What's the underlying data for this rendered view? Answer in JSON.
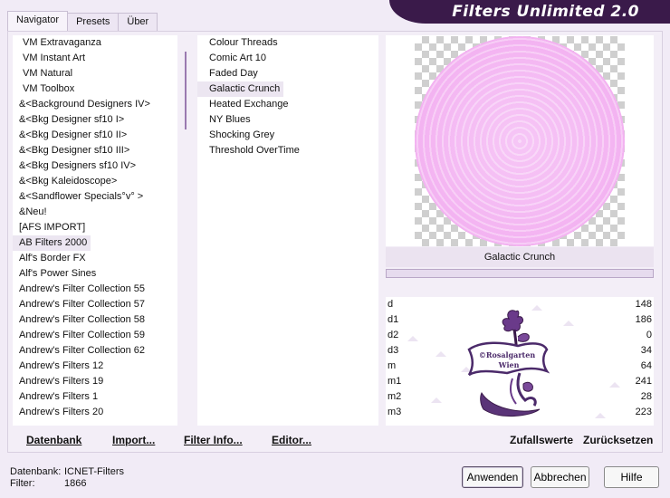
{
  "tabs": [
    "Navigator",
    "Presets",
    "Über"
  ],
  "banner_title": "Filters Unlimited 2.0",
  "categories": [
    "VM Extravaganza",
    "VM Instant Art",
    "VM Natural",
    "VM Toolbox",
    "&<Background Designers IV>",
    "&<Bkg Designer sf10 I>",
    "&<Bkg Designer sf10 II>",
    "&<Bkg Designer sf10 III>",
    "&<Bkg Designers sf10 IV>",
    "&<Bkg Kaleidoscope>",
    "&<Sandflower Specials°v° >",
    "&Neu!",
    "[AFS IMPORT]",
    "AB Filters 2000",
    "Alf's Border FX",
    "Alf's Power Sines",
    "Andrew's Filter Collection 55",
    "Andrew's Filter Collection 57",
    "Andrew's Filter Collection 58",
    "Andrew's Filter Collection 59",
    "Andrew's Filter Collection 62",
    "Andrew's Filters 12",
    "Andrew's Filters 19",
    "Andrew's Filters 1",
    "Andrew's Filters 20"
  ],
  "selected_category": "AB Filters 2000",
  "filters": [
    "Colour Threads",
    "Comic Art 10",
    "Faded Day",
    "Galactic Crunch",
    "Heated Exchange",
    "NY Blues",
    "Shocking Grey",
    "Threshold OverTime"
  ],
  "selected_filter": "Galactic Crunch",
  "preview_filter_name": "Galactic Crunch",
  "params": [
    {
      "name": "d",
      "value": "148"
    },
    {
      "name": "d1",
      "value": "186"
    },
    {
      "name": "d2",
      "value": "0"
    },
    {
      "name": "d3",
      "value": "34"
    },
    {
      "name": "m",
      "value": "64"
    },
    {
      "name": "m1",
      "value": "241"
    },
    {
      "name": "m2",
      "value": "28"
    },
    {
      "name": "m3",
      "value": "223"
    }
  ],
  "toolbar": {
    "database": "Datenbank",
    "import": "Import...",
    "filter_info": "Filter Info...",
    "editor": "Editor...",
    "random": "Zufallswerte",
    "reset": "Zurücksetzen"
  },
  "status": {
    "database_label": "Datenbank:",
    "database_value": "ICNET-Filters",
    "filter_label": "Filter:",
    "filter_value": "1866"
  },
  "buttons": {
    "apply": "Anwenden",
    "cancel": "Abbrechen",
    "help": "Hilfe"
  },
  "watermark_text": [
    "©Rosalgarten",
    "Wien"
  ],
  "colors": {
    "banner": "#3a1a4a",
    "accent": "#9a7ab0",
    "preview_disc": "#f5bdf4",
    "watermark": "#4b2a6a"
  }
}
